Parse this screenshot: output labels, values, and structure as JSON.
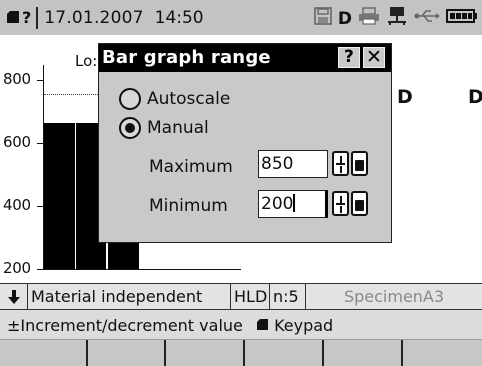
{
  "statusbar": {
    "memory_icon": "memory-card-icon",
    "help_glyph": "?",
    "date": "17.01.2007",
    "time": "14:50",
    "icons": [
      "save-icon",
      "d-mode-icon",
      "printer-icon",
      "network-icon",
      "usb-icon",
      "battery-icon"
    ],
    "mode_letter": "D"
  },
  "chart": {
    "y_ticks": [
      "800",
      "600",
      "400",
      "200"
    ],
    "lo_label": "Lo:",
    "column_letters": [
      "D",
      "D"
    ]
  },
  "chart_data": {
    "type": "bar",
    "categories": [
      "",
      "",
      ""
    ],
    "values": [
      665,
      665,
      665
    ],
    "ylim": [
      200,
      850
    ],
    "y_ticks": [
      800,
      600,
      400,
      200
    ],
    "xlabel": "",
    "ylabel": ""
  },
  "dialog": {
    "title": "Bar graph range",
    "help_label": "?",
    "close_label": "✕",
    "options": [
      {
        "label": "Autoscale",
        "selected": false
      },
      {
        "label": "Manual",
        "selected": true
      }
    ],
    "maximum": {
      "label": "Maximum",
      "value": "850"
    },
    "minimum": {
      "label": "Minimum",
      "value": "200"
    }
  },
  "info_row": {
    "arrow": "🠗",
    "material": "Material independent",
    "scale": "HLD",
    "count": "n:5",
    "specimen": "SpecimenA3"
  },
  "hint_row": {
    "increment_text": "±Increment/decrement value",
    "keypad_text": "Keypad"
  },
  "colors": {
    "statusbar_bg": "#c3c3c3",
    "dialog_bg": "#c9c9c9",
    "title_bg": "#000000",
    "specimen_text": "#8a8a8a"
  }
}
